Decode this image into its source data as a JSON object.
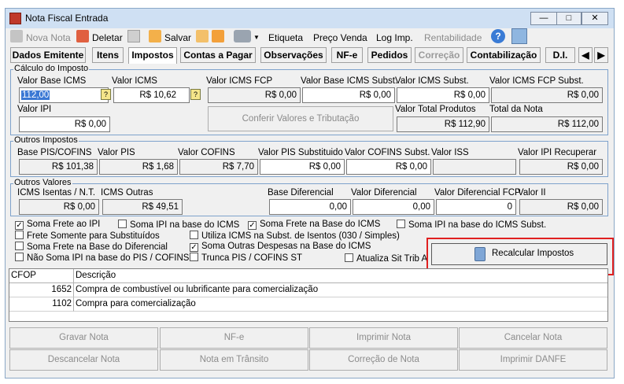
{
  "window": {
    "title": "Nota Fiscal Entrada"
  },
  "toolbar": {
    "nova": "Nova Nota",
    "deletar": "Deletar",
    "salvar": "Salvar",
    "etiqueta": "Etiqueta",
    "preco": "Preço Venda",
    "log": "Log Imp.",
    "rentab": "Rentabilidade"
  },
  "tabs": [
    "Dados Emitente",
    "Itens",
    "Impostos",
    "Contas a Pagar",
    "Observações",
    "NF-e",
    "Pedidos",
    "Correção",
    "Contabilização",
    "D.I."
  ],
  "calc": {
    "title": "Cálculo do Imposto",
    "vbicms": "Valor Base ICMS",
    "vbicms_v": "112,00",
    "vicms": "Valor ICMS",
    "vicms_v": "R$ 10,62",
    "vicmsfcp": "Valor ICMS FCP",
    "vicmsfcp_v": "R$ 0,00",
    "vbsubst": "Valor Base ICMS Subst.",
    "vbsubst_v": "R$ 0,00",
    "vsubst": "Valor ICMS Subst.",
    "vsubst_v": "R$ 0,00",
    "vfcpsubst": "Valor ICMS FCP Subst.",
    "vfcpsubst_v": "R$ 0,00",
    "vipi": "Valor IPI",
    "vipi_v": "R$ 0,00",
    "conferir": "Conferir Valores e Tributação",
    "vprod": "Valor Total Produtos",
    "vprod_v": "R$ 112,90",
    "vnota": "Total da Nota",
    "vnota_v": "R$ 112,00"
  },
  "outros": {
    "title": "Outros Impostos",
    "bpis": "Base PIS/COFINS",
    "bpis_v": "R$ 101,38",
    "vpis": "Valor PIS",
    "vpis_v": "R$ 1,68",
    "vcof": "Valor COFINS",
    "vcof_v": "R$ 7,70",
    "vpissub": "Valor PIS Substituido",
    "vpissub_v": "R$ 0,00",
    "vcofsub": "Valor COFINS Subst.",
    "vcofsub_v": "R$ 0,00",
    "viss": "Valor ISS",
    "viss_v": "",
    "vipirec": "Valor IPI Recuperar",
    "vipirec_v": "R$ 0,00"
  },
  "valores": {
    "title": "Outros Valores",
    "isentas": "ICMS Isentas / N.T.",
    "isentas_v": "R$ 0,00",
    "outras": "ICMS Outras",
    "outras_v": "R$ 49,51",
    "bdif": "Base Diferencial",
    "bdif_v": "0,00",
    "vdif": "Valor Diferencial",
    "vdif_v": "0,00",
    "vdiffcp": "Valor Diferencial FCP",
    "vdiffcp_v": "0",
    "vii": "Valor II",
    "vii_v": "R$ 0,00"
  },
  "checks": [
    {
      "label": "Soma Frete ao IPI",
      "checked": true
    },
    {
      "label": "Soma IPI na base do ICMS",
      "checked": false
    },
    {
      "label": "Soma Frete na Base do ICMS",
      "checked": true
    },
    {
      "label": "Soma IPI na base do ICMS Subst.",
      "checked": false
    },
    {
      "label": "Frete Somente para Substituídos",
      "checked": false
    },
    {
      "label": "Utiliza ICMS na Subst. de Isentos (030 / Simples)",
      "checked": false
    },
    {
      "label": "Soma Frete na Base do Diferencial",
      "checked": false
    },
    {
      "label": "Soma Outras Despesas na Base do ICMS",
      "checked": true
    },
    {
      "label": "Não Soma IPI na base do PIS / COFINS",
      "checked": false
    },
    {
      "label": "Trunca PIS / COFINS ST",
      "checked": false
    },
    {
      "label": "Atualiza Sit Trib A",
      "checked": false
    }
  ],
  "recalc": "Recalcular Impostos",
  "grid": {
    "h_cfop": "CFOP",
    "h_desc": "Descrição",
    "rows": [
      {
        "cfop": "1652",
        "desc": "Compra de combustível ou lubrificante para comercialização"
      },
      {
        "cfop": "1102",
        "desc": "Compra para comercialização"
      }
    ]
  },
  "buttons": [
    "Gravar Nota",
    "NF-e",
    "Imprimir Nota",
    "Cancelar Nota",
    "Descancelar Nota",
    "Nota em Trânsito",
    "Correção de Nota",
    "Imprimir DANFE"
  ],
  "colors": {
    "highlight": "#e02020",
    "titlebar": "#cfe0f3",
    "group_border": "#7ea2cc"
  }
}
